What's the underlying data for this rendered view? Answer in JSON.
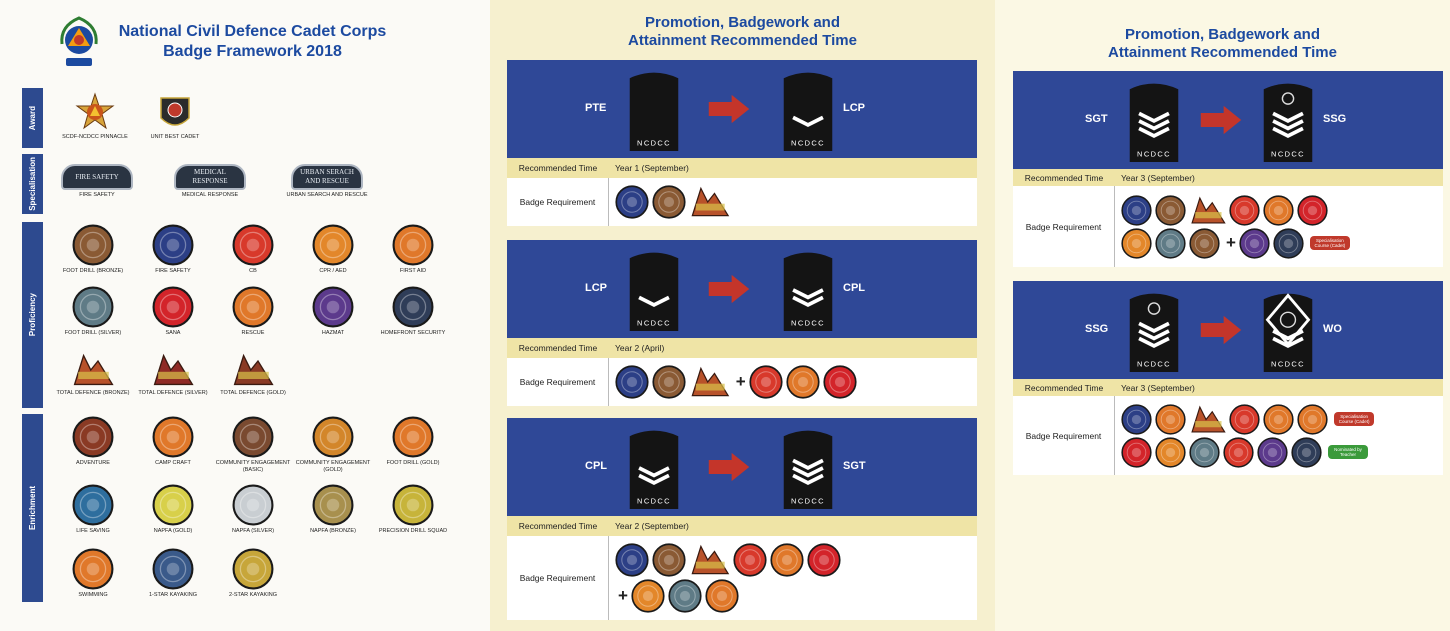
{
  "framework": {
    "title_line1": "National Civil Defence Cadet Corps",
    "title_line2": "Badge Framework 2018",
    "sections": {
      "award": "Award",
      "specialisation": "Specialisation",
      "proficiency": "Proficiency",
      "enrichment": "Enrichment"
    },
    "award_badges": [
      {
        "label": "SCDF-NCDCC PINNACLE",
        "color": "#c9541a"
      },
      {
        "label": "UNIT BEST CADET",
        "color": "#2b2b2b"
      }
    ],
    "specialisation_badges": [
      {
        "badge_text": "FIRE SAFETY",
        "label": "FIRE SAFETY"
      },
      {
        "badge_text": "MEDICAL RESPONSE",
        "label": "MEDICAL RESPONSE"
      },
      {
        "badge_text": "URBAN SERACH AND RESCUE",
        "label": "URBAN SEARCH AND RESCUE"
      }
    ],
    "proficiency_badges": [
      {
        "label": "FOOT DRILL (BRONZE)",
        "color": "#8a5a34"
      },
      {
        "label": "FIRE SAFETY",
        "color": "#2c3f86"
      },
      {
        "label": "CB",
        "color": "#d8392b"
      },
      {
        "label": "CPR / AED",
        "color": "#e3872a"
      },
      {
        "label": "FIRST AID",
        "color": "#e0782a"
      },
      {
        "label": "FOOT DRILL (SILVER)",
        "color": "#5f7b86"
      },
      {
        "label": "SANA",
        "color": "#d3242a"
      },
      {
        "label": "RESCUE",
        "color": "#e0782a"
      },
      {
        "label": "HAZMAT",
        "color": "#5c3a8c"
      },
      {
        "label": "HOMEFRONT SECURITY",
        "color": "#2f3d58"
      },
      {
        "label": "TOTAL DEFENCE (BRONZE)",
        "color": "#b8522a"
      },
      {
        "label": "TOTAL DEFENCE (SILVER)",
        "color": "#8f2a25"
      },
      {
        "label": "TOTAL DEFENCE (GOLD)",
        "color": "#8a3a24"
      }
    ],
    "enrichment_badges": [
      {
        "label": "ADVENTURE",
        "color": "#8a3a24"
      },
      {
        "label": "CAMP CRAFT",
        "color": "#e0782a"
      },
      {
        "label": "COMMUNITY ENGAGEMENT (BASIC)",
        "color": "#7a4a30"
      },
      {
        "label": "COMMUNITY ENGAGEMENT (GOLD)",
        "color": "#d3862a"
      },
      {
        "label": "FOOT DRILL (GOLD)",
        "color": "#e0782a"
      },
      {
        "label": "LIFE SAVING",
        "color": "#2e6e9e"
      },
      {
        "label": "NAPFA (GOLD)",
        "color": "#d8d04a"
      },
      {
        "label": "NAPFA (SILVER)",
        "color": "#c9ced2"
      },
      {
        "label": "NAPFA (BRONZE)",
        "color": "#a8904e"
      },
      {
        "label": "PRECISION DRILL SQUAD",
        "color": "#c7b43a"
      },
      {
        "label": "SWIMMING",
        "color": "#e0782a"
      },
      {
        "label": "1-STAR KAYAKING",
        "color": "#3a5a8a"
      },
      {
        "label": "2-STAR KAYAKING",
        "color": "#c7a63a"
      }
    ]
  },
  "promotion_page": {
    "title_line1": "Promotion, Badgework and",
    "title_line2": "Attainment Recommended Time",
    "row_time_label": "Recommended Time",
    "row_badge_label": "Badge Requirement",
    "epaulette_text": "NCDCC",
    "blocks": [
      {
        "from": "PTE",
        "to": "LCP",
        "time": "Year 1 (September)",
        "badges": [
          "#2c3f86",
          "#8a5a34",
          "tdbronze"
        ]
      },
      {
        "from": "LCP",
        "to": "CPL",
        "time": "Year 2 (April)",
        "badges": [
          "#2c3f86",
          "#8a5a34",
          "tdbronze",
          "+",
          "#d8392b",
          "#e0782a",
          "#d3242a"
        ]
      },
      {
        "from": "CPL",
        "to": "SGT",
        "time": "Year 2 (September)",
        "badges": [
          "#2c3f86",
          "#8a5a34",
          "tdbronze",
          "#d8392b",
          "#e0782a",
          "#d3242a",
          "br",
          "+",
          "#e3872a",
          "#5f7b86",
          "#e0782a"
        ]
      }
    ]
  },
  "promotion_page2": {
    "title_line1": "Promotion, Badgework and",
    "title_line2": "Attainment Recommended Time",
    "row_time_label": "Recommended Time",
    "row_badge_label": "Badge Requirement",
    "epaulette_text": "NCDCC",
    "blocks": [
      {
        "from": "SGT",
        "to": "SSG",
        "time": "Year 3 (September)",
        "badges": [
          "#2c3f86",
          "#8a5a34",
          "tdbronze",
          "#d8392b",
          "#e0782a",
          "#d3242a",
          "br",
          "#e3872a",
          "#5f7b86",
          "#8a5a34",
          "+",
          "#5c3a8c",
          "#2f3d58"
        ],
        "note": "Specialisation Course (Cadet)",
        "note_color": "#c0392b"
      },
      {
        "from": "SSG",
        "to": "WO",
        "time": "Year 3 (September)",
        "badges": [
          "#2c3f86",
          "#e0782a",
          "tdbronze",
          "#d8392b",
          "#e0782a",
          "#e0782a",
          "br",
          "#d3242a",
          "#e3872a",
          "#5f7b86",
          "#d8392b",
          "#5c3a8c",
          "#2f3d58"
        ],
        "note": "Specialisation Course (Cadet)",
        "note_color": "#c0392b",
        "note2": "Nominated by Teacher",
        "note2_color": "#3a9a3a"
      }
    ]
  }
}
